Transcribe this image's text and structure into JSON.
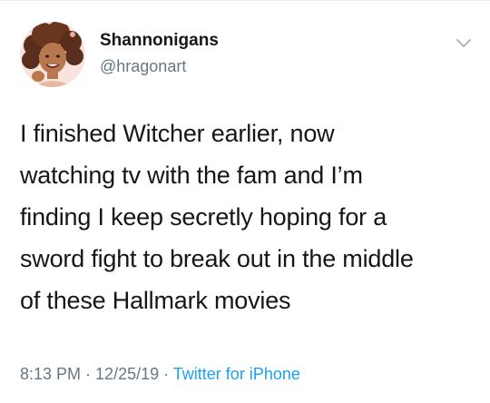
{
  "author": {
    "display_name": "Shannonigans",
    "handle": "@hragonart",
    "avatar_icon": "illustrated-portrait-avatar"
  },
  "tweet": {
    "lines": [
      "I finished Witcher earlier, now",
      "watching tv with the fam and I’m",
      "finding I keep secretly hoping for a",
      "sword fight to break out in the middle",
      "of these Hallmark movies"
    ]
  },
  "meta": {
    "time": "8:13 PM",
    "separator": " · ",
    "date": "12/25/19",
    "source": "Twitter for iPhone"
  },
  "menu": {
    "icon": "chevron-down-icon"
  },
  "colors": {
    "text": "#14171a",
    "secondary": "#657786",
    "link": "#1da1f2",
    "chevron": "#aab8c2"
  }
}
